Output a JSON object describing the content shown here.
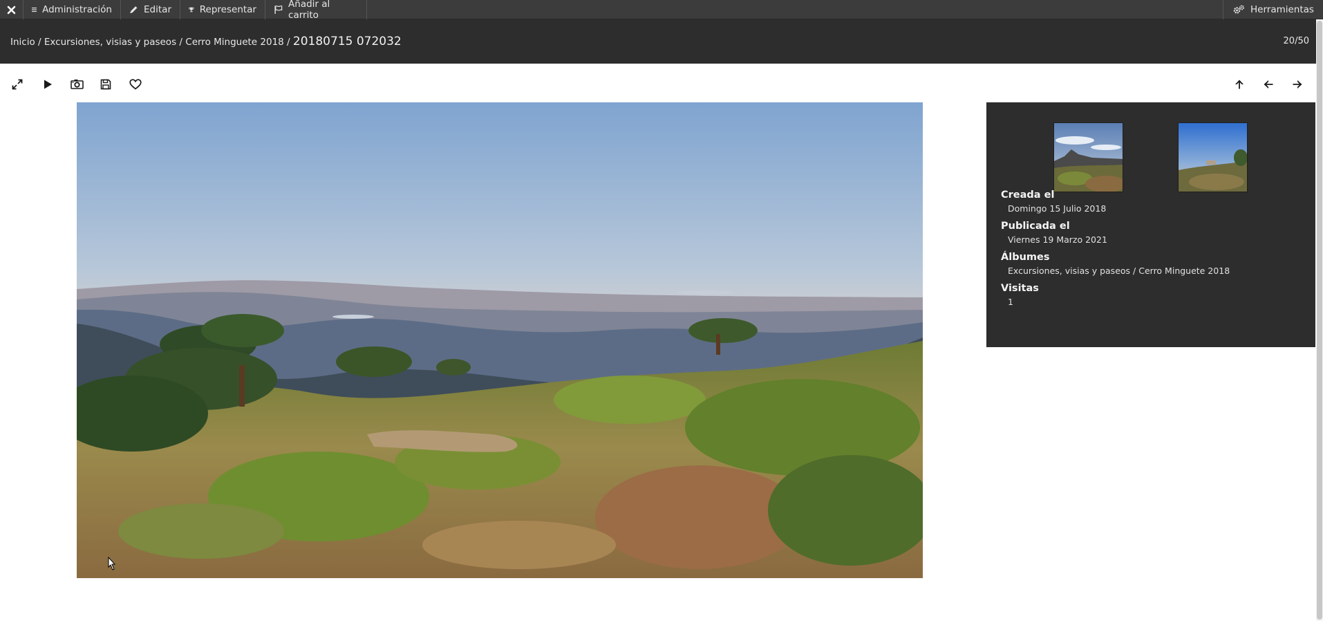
{
  "adminbar": {
    "close_label": "×",
    "admin_label": "Administración",
    "edit_label": "Editar",
    "represent_label": "Representar",
    "cart_label": "Añadir al carrito",
    "tools_label": "Herramientas"
  },
  "breadcrumb": {
    "home": "Inicio",
    "album": "Excursiones, visias y paseos",
    "subalbum": "Cerro Minguete 2018",
    "current": "20180715 072032",
    "separator": "/"
  },
  "counter": "20/50",
  "toolbar": {
    "left_icons": [
      "fullscreen-icon",
      "play-icon",
      "camera-icon",
      "save-icon",
      "heart-icon"
    ],
    "right_icons": [
      "arrow-up-icon",
      "arrow-left-icon",
      "arrow-right-icon"
    ]
  },
  "info": {
    "created_label": "Creada el",
    "created_value": "Domingo 15 Julio 2018",
    "published_label": "Publicada el",
    "published_value": "Viernes 19 Marzo 2021",
    "albums_label": "Álbumes",
    "albums_value_album": "Excursiones, visias y paseos",
    "albums_value_separator": "/",
    "albums_value_subalbum": "Cerro Minguete 2018",
    "visits_label": "Visitas",
    "visits_value": "1"
  },
  "colors": {
    "adminbar_bg": "#3c3c3c",
    "header_bg": "#2d2d2d",
    "panel_bg": "#2d2d2d",
    "text_light": "#eeeeee"
  }
}
